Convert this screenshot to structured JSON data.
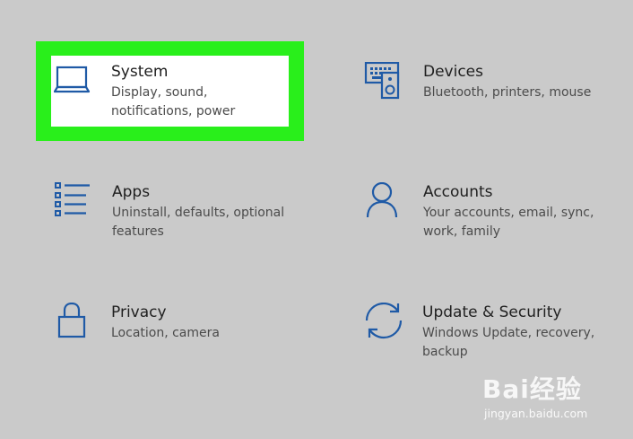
{
  "settings": {
    "tiles": [
      {
        "title": "System",
        "description": "Display, sound, notifications, power",
        "icon": "laptop-icon",
        "highlighted": true
      },
      {
        "title": "Devices",
        "description": "Bluetooth, printers, mouse",
        "icon": "devices-icon"
      },
      {
        "title": "Apps",
        "description": "Uninstall, defaults, optional features",
        "icon": "apps-list-icon"
      },
      {
        "title": "Accounts",
        "description": "Your accounts, email, sync, work, family",
        "icon": "person-icon"
      },
      {
        "title": "Privacy",
        "description": "Location, camera",
        "icon": "lock-icon"
      },
      {
        "title": "Update & Security",
        "description": "Windows Update, recovery, backup",
        "icon": "sync-icon"
      }
    ]
  },
  "colors": {
    "background": "#cacaca",
    "icon_blue": "#1f5aa6",
    "highlight_green": "#29ef1b"
  },
  "watermark": {
    "logo": "Bai经验",
    "url": "jingyan.baidu.com"
  }
}
